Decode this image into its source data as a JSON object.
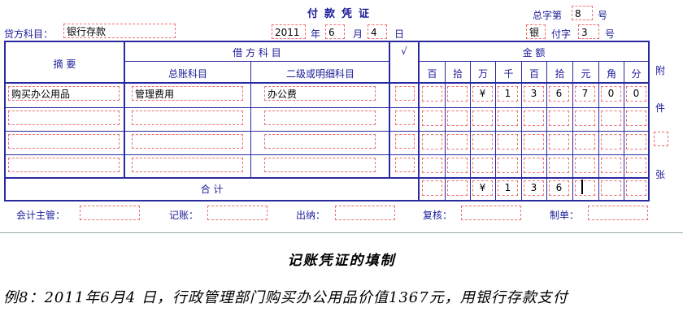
{
  "voucher": {
    "title": "付款凭证",
    "total_no_label": "总字第",
    "total_no": "8",
    "hao1": "号",
    "credit_account_label": "贷方科目：",
    "credit_account": "银行存款",
    "year": "2011",
    "year_label": "年",
    "month": "6",
    "month_label": "月",
    "day": "4",
    "day_label": "日",
    "bank_char": "银",
    "fu_label": "付字",
    "fu_no": "3",
    "hao2": "号"
  },
  "table": {
    "summary_header": "摘  要",
    "debit_header": "借 方 科 目",
    "general_ledger_header": "总账科目",
    "sub_ledger_header": "二级或明细科目",
    "check_header": "√",
    "amount_header": "金  额",
    "digit_headers": [
      "百",
      "拾",
      "万",
      "千",
      "百",
      "拾",
      "元",
      "角",
      "分"
    ],
    "attach_chars": [
      "附",
      "件",
      "张"
    ],
    "rows": [
      {
        "summary": "购买办公用品",
        "general": "管理费用",
        "sub": "办公费",
        "digits": [
          "",
          "",
          "¥",
          "1",
          "3",
          "6",
          "7",
          "0",
          "0"
        ]
      },
      {
        "summary": "",
        "general": "",
        "sub": "",
        "digits": [
          "",
          "",
          "",
          "",
          "",
          "",
          "",
          "",
          ""
        ]
      },
      {
        "summary": "",
        "general": "",
        "sub": "",
        "digits": [
          "",
          "",
          "",
          "",
          "",
          "",
          "",
          "",
          ""
        ]
      },
      {
        "summary": "",
        "general": "",
        "sub": "",
        "digits": [
          "",
          "",
          "",
          "",
          "",
          "",
          "",
          "",
          ""
        ]
      }
    ],
    "total_label": "合  计",
    "total_digits": [
      "",
      "",
      "¥",
      "1",
      "3",
      "6",
      "",
      "",
      ""
    ]
  },
  "footer": {
    "accountant_label": "会计主管：",
    "bookkeeping_label": "记账：",
    "cashier_label": "出纳：",
    "review_label": "复核：",
    "maker_label": "制单："
  },
  "lesson": {
    "title": "记账凭证的填制",
    "example": "例8：2011年6月4 日，行政管理部门购买办公用品价值1367元，用银行存款支付"
  }
}
